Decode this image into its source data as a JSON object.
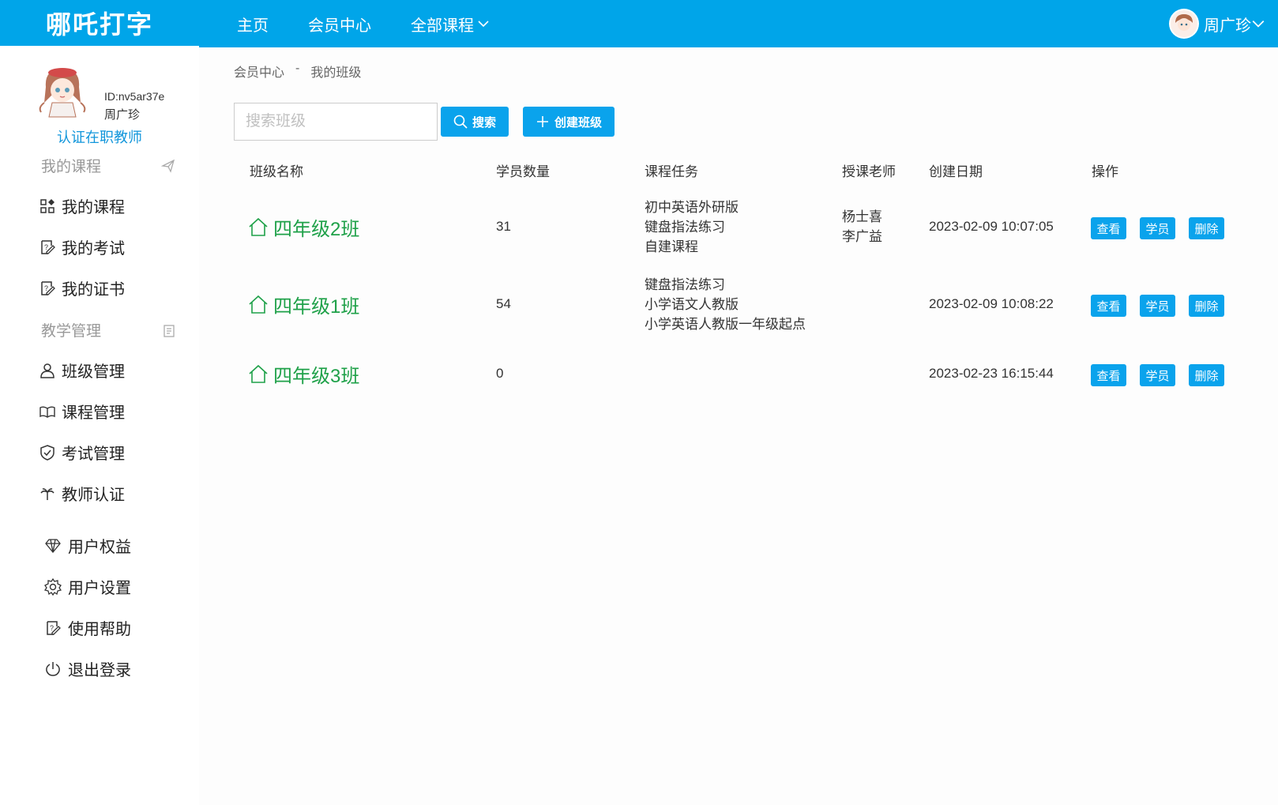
{
  "header": {
    "logo": "哪吒打字",
    "nav": [
      "主页",
      "会员中心",
      "全部课程"
    ],
    "user_name": "周广珍"
  },
  "sidebar": {
    "user_id": "ID:nv5ar37e",
    "user_name": "周广珍",
    "certify_link": "认证在职教师",
    "section_courses": "我的课程",
    "course_items": [
      "我的课程",
      "我的考试",
      "我的证书"
    ],
    "section_teaching": "教学管理",
    "teaching_items": [
      "班级管理",
      "课程管理",
      "考试管理",
      "教师认证"
    ],
    "account_items": [
      "用户权益",
      "用户设置",
      "使用帮助",
      "退出登录"
    ]
  },
  "breadcrumb": {
    "parent": "会员中心",
    "separator": "-",
    "current": "我的班级"
  },
  "toolbar": {
    "search_placeholder": "搜索班级",
    "search_label": "搜索",
    "create_label": "创建班级"
  },
  "table": {
    "headers": [
      "班级名称",
      "学员数量",
      "课程任务",
      "授课老师",
      "创建日期",
      "操作"
    ],
    "rows": [
      {
        "name": "四年级2班",
        "count": "31",
        "tasks": [
          "初中英语外研版",
          "键盘指法练习",
          "自建课程"
        ],
        "teachers": [
          "杨士喜",
          "李广益"
        ],
        "date": "2023-02-09 10:07:05"
      },
      {
        "name": "四年级1班",
        "count": "54",
        "tasks": [
          "键盘指法练习",
          "小学语文人教版",
          "小学英语人教版一年级起点"
        ],
        "teachers": [],
        "date": "2023-02-09 10:08:22"
      },
      {
        "name": "四年级3班",
        "count": "0",
        "tasks": [],
        "teachers": [],
        "date": "2023-02-23 16:15:44"
      }
    ],
    "actions": [
      "查看",
      "学员",
      "删除"
    ]
  },
  "colors": {
    "primary": "#00a5e9",
    "green": "#1fa149",
    "link": "#1296db"
  }
}
